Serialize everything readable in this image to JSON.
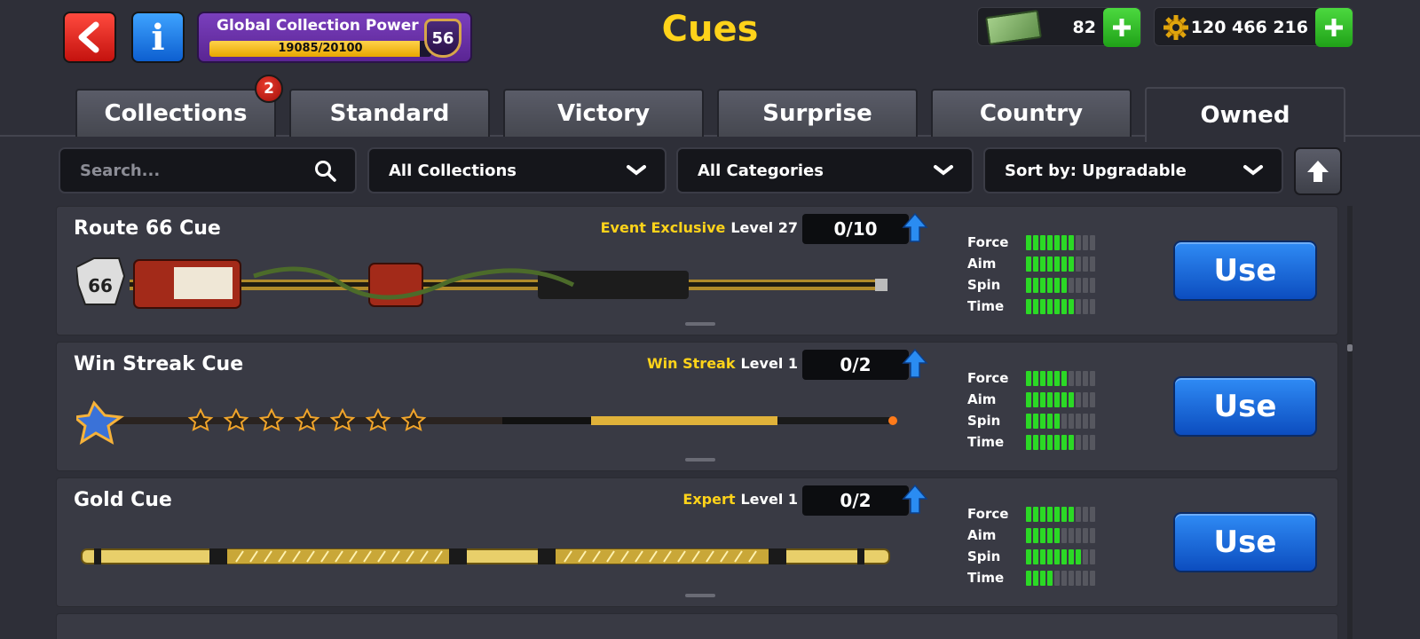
{
  "header": {
    "title": "Cues",
    "global_power": {
      "label": "Global Collection Power",
      "current": 19085,
      "max": 20100,
      "text": "19085/20100",
      "level": "56"
    },
    "cash": "82",
    "coins": "120 466 216"
  },
  "tabs": [
    {
      "label": "Collections",
      "active": false,
      "badge": "2"
    },
    {
      "label": "Standard",
      "active": false
    },
    {
      "label": "Victory",
      "active": false
    },
    {
      "label": "Surprise",
      "active": false
    },
    {
      "label": "Country",
      "active": false
    },
    {
      "label": "Owned",
      "active": true
    }
  ],
  "filters": {
    "search_placeholder": "Search...",
    "collection": "All Collections",
    "category": "All Categories",
    "sort": "Sort by: Upgradable"
  },
  "stat_labels": {
    "force": "Force",
    "aim": "Aim",
    "spin": "Spin",
    "time": "Time"
  },
  "cues": [
    {
      "name": "Route 66 Cue",
      "category": "Event Exclusive",
      "level": "Level 27",
      "progress": "0/10",
      "stats": {
        "force": 7,
        "aim": 7,
        "spin": 6,
        "time": 7
      },
      "button": "Use"
    },
    {
      "name": "Win Streak Cue",
      "category": "Win Streak",
      "level": "Level 1",
      "progress": "0/2",
      "stats": {
        "force": 6,
        "aim": 7,
        "spin": 5,
        "time": 7
      },
      "button": "Use"
    },
    {
      "name": "Gold Cue",
      "category": "Expert",
      "level": "Level 1",
      "progress": "0/2",
      "stats": {
        "force": 7,
        "aim": 5,
        "spin": 8,
        "time": 4
      },
      "button": "Use"
    }
  ],
  "stat_max": 10,
  "colors": {
    "accent_yellow": "#ffd31a",
    "stat_on": "#2bd925",
    "use_button": "#1f6fe0"
  }
}
